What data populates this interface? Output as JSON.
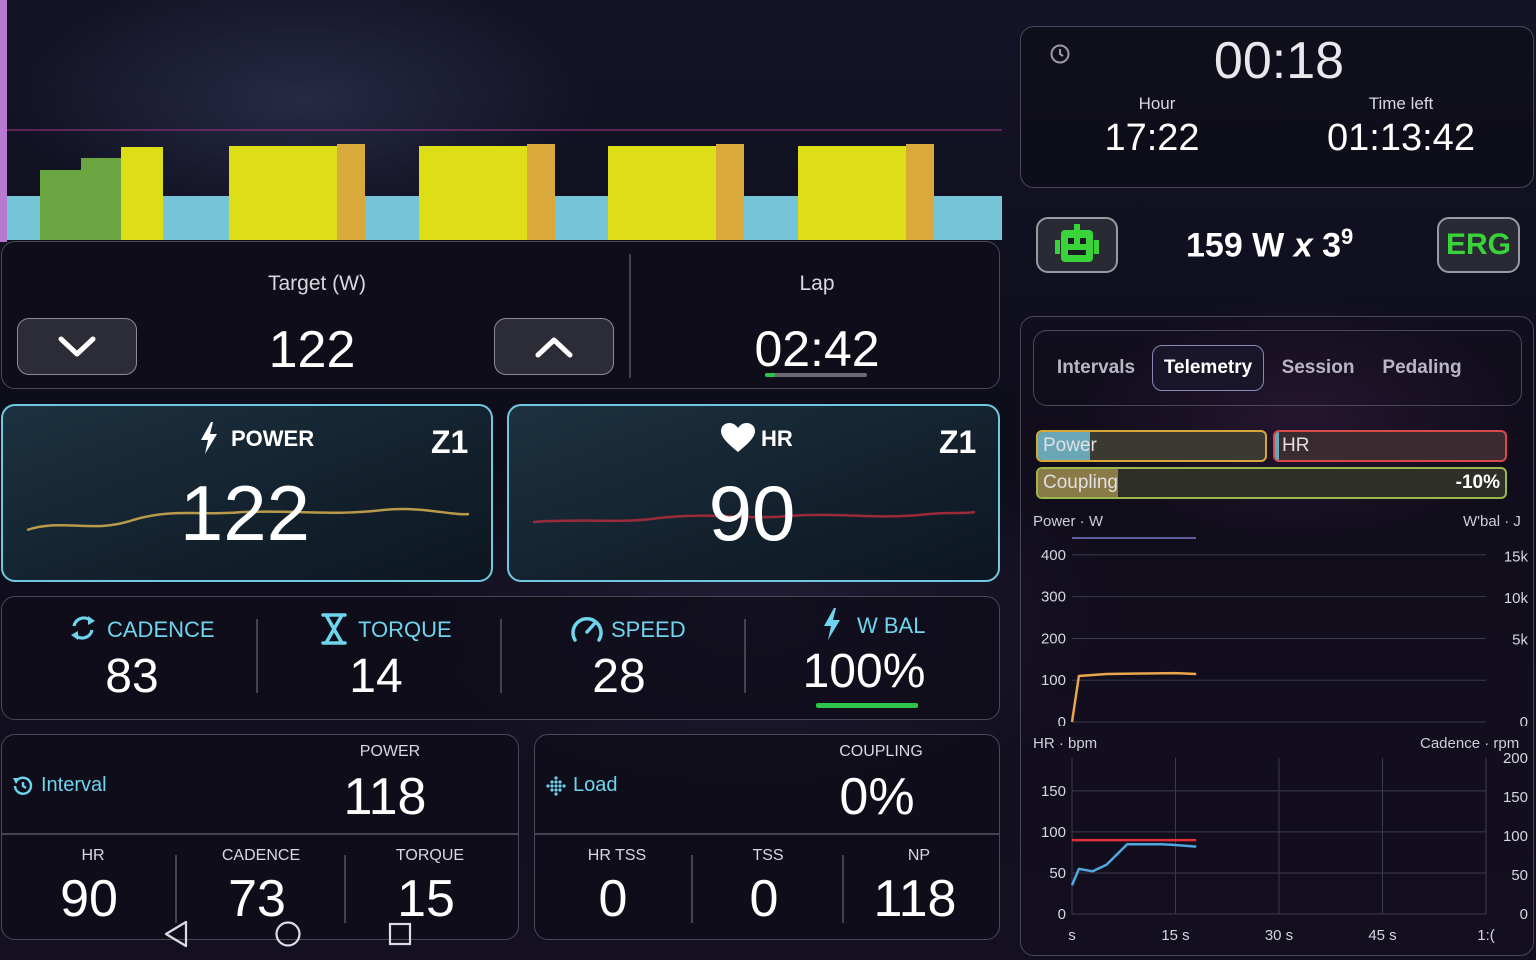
{
  "workout_chart": {
    "bg_color": "#76c4d8",
    "colors": {
      "green": "#6aa542",
      "yellow": "#dede16",
      "orange": "#d9a93c",
      "recovery": "#76c4d8"
    },
    "progress_line_color": "#b040a6"
  },
  "target": {
    "label": "Target (W)",
    "value": "122",
    "down_icon": "chevron-down-icon",
    "up_icon": "chevron-up-icon"
  },
  "lap": {
    "label": "Lap",
    "value": "02:42",
    "progress": 0.1
  },
  "power_tile": {
    "label": "POWER",
    "zone": "Z1",
    "value": "122",
    "icon": "bolt-icon",
    "line_color": "#b89a4a"
  },
  "hr_tile": {
    "label": "HR",
    "zone": "Z1",
    "value": "90",
    "icon": "heart-icon",
    "line_color": "#9b2a3a"
  },
  "metrics": [
    {
      "label": "CADENCE",
      "value": "83",
      "icon": "refresh-icon"
    },
    {
      "label": "TORQUE",
      "value": "14",
      "icon": "hourglass-icon"
    },
    {
      "label": "SPEED",
      "value": "28",
      "icon": "speedometer-icon"
    },
    {
      "label": "W BAL",
      "value": "100%",
      "icon": "bolt-icon",
      "bar_color": "#2ec44a"
    }
  ],
  "interval_panel": {
    "title": "Interval",
    "main_label": "POWER",
    "main_value": "118",
    "sub": [
      {
        "label": "HR",
        "value": "90"
      },
      {
        "label": "CADENCE",
        "value": "73"
      },
      {
        "label": "TORQUE",
        "value": "15"
      }
    ]
  },
  "load_panel": {
    "title": "Load",
    "main_label": "COUPLING",
    "main_value": "0%",
    "sub": [
      {
        "label": "HR TSS",
        "value": "0"
      },
      {
        "label": "TSS",
        "value": "0"
      },
      {
        "label": "NP",
        "value": "118"
      }
    ]
  },
  "clock": {
    "elapsed": "00:18",
    "hour_label": "Hour",
    "hour_value": "17:22",
    "time_left_label": "Time left",
    "time_left_value": "01:13:42",
    "icon": "clock-icon"
  },
  "mode_row": {
    "robot_icon": "robot-icon",
    "target": "159 W",
    "multiplier_symbol": "x",
    "repeat_base": "3",
    "repeat_exp": "9",
    "mode_button": "ERG",
    "accent": "#39d33a"
  },
  "tabs": [
    {
      "label": "Intervals",
      "active": false
    },
    {
      "label": "Telemetry",
      "active": true
    },
    {
      "label": "Session",
      "active": false
    },
    {
      "label": "Pedaling",
      "active": false
    }
  ],
  "telemetry": {
    "power_bar_label": "Power",
    "hr_bar_label": "HR",
    "coupling_label": "Coupling",
    "coupling_value": "-10%",
    "chart1": {
      "left_title": "Power · W",
      "right_title": "W'bal · J",
      "left_ticks": [
        "400",
        "300",
        "200",
        "100",
        "0"
      ],
      "right_ticks": [
        "15k",
        "10k",
        "5k",
        "0"
      ]
    },
    "chart2": {
      "left_title": "HR · bpm",
      "right_title": "Cadence · rpm",
      "left_ticks": [
        "150",
        "100",
        "50",
        "0"
      ],
      "right_ticks": [
        "200",
        "150",
        "100",
        "50",
        "0"
      ],
      "x_ticks": [
        "s",
        "15 s",
        "30 s",
        "45 s",
        "1:("
      ]
    }
  },
  "chart_data": [
    {
      "type": "line",
      "x": [
        0,
        1,
        5,
        10,
        15,
        18
      ],
      "series": [
        {
          "values": [
            0,
            110,
            115,
            116,
            117,
            115
          ],
          "color": "#e9a64a"
        }
      ],
      "ylim": [
        0,
        450
      ],
      "xlim": [
        0,
        60
      ],
      "xlabel": "",
      "ylabel": "Power · W",
      "ylabel_right": "W'bal · J",
      "y_ticks": [
        400,
        300,
        200,
        100,
        0
      ],
      "y_right_ticks": [
        "15k",
        "10k",
        "5k",
        "0"
      ],
      "grid": true,
      "legend": "none"
    },
    {
      "type": "line",
      "x": [
        0,
        1,
        3,
        5,
        8,
        10,
        13,
        15,
        18
      ],
      "series": [
        {
          "values": [
            90,
            90,
            90,
            90,
            90,
            90,
            90,
            90,
            90
          ],
          "color": "#e0303a"
        },
        {
          "values": [
            35,
            55,
            52,
            60,
            85,
            85,
            85,
            84,
            82
          ],
          "color": "#4fa8e0"
        }
      ],
      "ylim": [
        0,
        190
      ],
      "xlim": [
        0,
        60
      ],
      "ylabel": "HR · bpm",
      "ylabel_right": "Cadence · rpm",
      "y_ticks": [
        150,
        100,
        50,
        0
      ],
      "y_right_ticks": [
        200,
        150,
        100,
        50,
        0
      ],
      "x_ticks": [
        "s",
        "15 s",
        "30 s",
        "45 s",
        "1:("
      ],
      "grid": true,
      "legend": "none"
    }
  ]
}
